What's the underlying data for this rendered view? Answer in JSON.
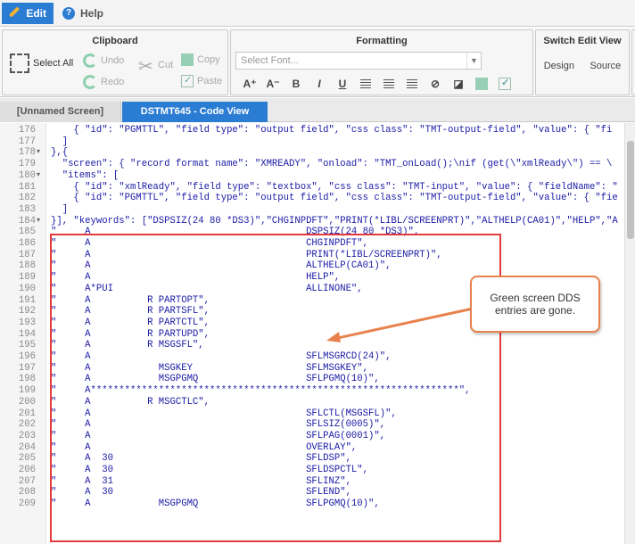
{
  "menu": {
    "edit_label": "Edit",
    "help_label": "Help"
  },
  "ribbon": {
    "clipboard": {
      "title": "Clipboard",
      "select_all": "Select All",
      "undo": "Undo",
      "redo": "Redo",
      "cut": "Cut",
      "copy": "Copy",
      "paste": "Paste"
    },
    "formatting": {
      "title": "Formatting",
      "font_placeholder": "Select Font..."
    },
    "switch_view": {
      "title": "Switch Edit View",
      "design": "Design",
      "source": "Source"
    }
  },
  "tabs": [
    {
      "label": "[Unnamed Screen]"
    },
    {
      "label": "DSTMT645 - Code View"
    }
  ],
  "code_lines": [
    {
      "n": "176",
      "fold": "",
      "text": "    { \"id\": \"PGMTTL\", \"field type\": \"output field\", \"css class\": \"TMT-output-field\", \"value\": { \"fi"
    },
    {
      "n": "177",
      "fold": "",
      "text": "  ]"
    },
    {
      "n": "178",
      "fold": "▾",
      "text": "},{"
    },
    {
      "n": "179",
      "fold": "",
      "text": "  \"screen\": { \"record format name\": \"XMREADY\", \"onload\": \"TMT_onLoad();\\nif (get(\\\"xmlReady\\\") == \\"
    },
    {
      "n": "180",
      "fold": "▾",
      "text": "  \"items\": ["
    },
    {
      "n": "181",
      "fold": "",
      "text": "    { \"id\": \"xmlReady\", \"field type\": \"textbox\", \"css class\": \"TMT-input\", \"value\": { \"fieldName\": \""
    },
    {
      "n": "182",
      "fold": "",
      "text": "    { \"id\": \"PGMTTL\", \"field type\": \"output field\", \"css class\": \"TMT-output-field\", \"value\": { \"fie"
    },
    {
      "n": "183",
      "fold": "",
      "text": "  ]"
    },
    {
      "n": "184",
      "fold": "▾",
      "text": "}], \"keywords\": [\"DSPSIZ(24 80 *DS3)\",\"CHGINPDFT\",\"PRINT(*LIBL/SCREENPRT)\",\"ALTHELP(CA01)\",\"HELP\",\"A"
    },
    {
      "n": "185",
      "fold": "",
      "text": "\"     A                                      DSPSIZ(24 80 *DS3)\","
    },
    {
      "n": "186",
      "fold": "",
      "text": "\"     A                                      CHGINPDFT\","
    },
    {
      "n": "187",
      "fold": "",
      "text": "\"     A                                      PRINT(*LIBL/SCREENPRT)\","
    },
    {
      "n": "188",
      "fold": "",
      "text": "\"     A                                      ALTHELP(CA01)\","
    },
    {
      "n": "189",
      "fold": "",
      "text": "\"     A                                      HELP\","
    },
    {
      "n": "190",
      "fold": "",
      "text": "\"     A*PUI                                  ALLINONE\","
    },
    {
      "n": "191",
      "fold": "",
      "text": "\"     A          R PARTOPT\","
    },
    {
      "n": "192",
      "fold": "",
      "text": "\"     A          R PARTSFL\","
    },
    {
      "n": "193",
      "fold": "",
      "text": "\"     A          R PARTCTL\","
    },
    {
      "n": "194",
      "fold": "",
      "text": "\"     A          R PARTUPD\","
    },
    {
      "n": "195",
      "fold": "",
      "text": "\"     A          R MSGSFL\","
    },
    {
      "n": "196",
      "fold": "",
      "text": "\"     A                                      SFLMSGRCD(24)\","
    },
    {
      "n": "197",
      "fold": "",
      "text": "\"     A            MSGKEY                    SFLMSGKEY\","
    },
    {
      "n": "198",
      "fold": "",
      "text": "\"     A            MSGPGMQ                   SFLPGMQ(10)\","
    },
    {
      "n": "199",
      "fold": "",
      "text": "\"     A*****************************************************************\","
    },
    {
      "n": "200",
      "fold": "",
      "text": "\"     A          R MSGCTLC\","
    },
    {
      "n": "201",
      "fold": "",
      "text": "\"     A                                      SFLCTL(MSGSFL)\","
    },
    {
      "n": "202",
      "fold": "",
      "text": "\"     A                                      SFLSIZ(0005)\","
    },
    {
      "n": "203",
      "fold": "",
      "text": "\"     A                                      SFLPAG(0001)\","
    },
    {
      "n": "204",
      "fold": "",
      "text": "\"     A                                      OVERLAY\","
    },
    {
      "n": "205",
      "fold": "",
      "text": "\"     A  30                                  SFLDSP\","
    },
    {
      "n": "206",
      "fold": "",
      "text": "\"     A  30                                  SFLDSPCTL\","
    },
    {
      "n": "207",
      "fold": "",
      "text": "\"     A  31                                  SFLINZ\","
    },
    {
      "n": "208",
      "fold": "",
      "text": "\"     A  30                                  SFLEND\","
    },
    {
      "n": "209",
      "fold": "",
      "text": "\"     A            MSGPGMQ                   SFLPGMQ(10)\","
    }
  ],
  "callout": {
    "text": "Green screen DDS entries are gone."
  },
  "colors": {
    "accent": "#2b7cd3",
    "highlight_border": "#e53a3a",
    "callout_border": "#e8824d"
  }
}
